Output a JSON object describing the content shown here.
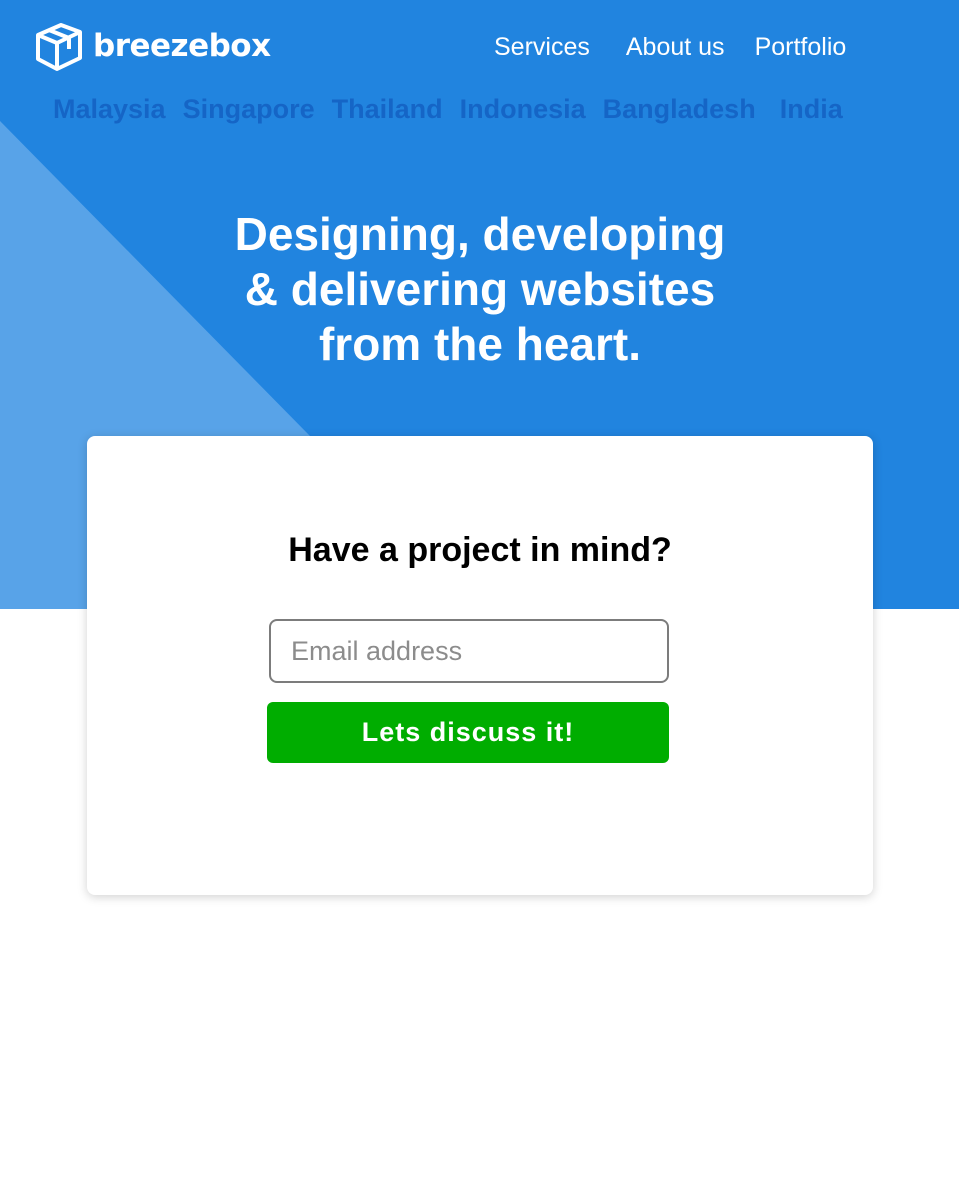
{
  "brand": {
    "name": "breezebox",
    "logo_icon": "box-icon"
  },
  "nav": {
    "items": [
      {
        "label": "Services"
      },
      {
        "label": "About us"
      },
      {
        "label": "Portfolio"
      }
    ]
  },
  "countries": [
    "Malaysia",
    "Singapore",
    "Thailand",
    "Indonesia",
    "Bangladesh",
    "India"
  ],
  "hero": {
    "headline_lines": [
      "Designing, developing",
      "& delivering websites",
      "from the heart."
    ]
  },
  "contact_card": {
    "title": "Have a project in mind?",
    "email_placeholder": "Email address",
    "email_value": "",
    "submit_label": "Lets discuss it!"
  },
  "colors": {
    "hero_background": "#2184df",
    "hero_triangle": "#58a3e8",
    "country_text": "#1565c6",
    "button_background": "#00ad00",
    "text_white": "#ffffff"
  }
}
